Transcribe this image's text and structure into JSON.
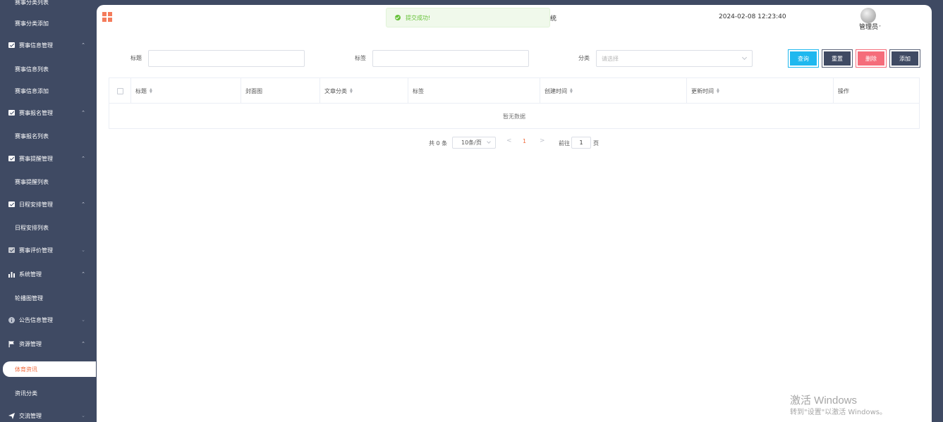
{
  "sidebar": {
    "items": [
      {
        "label": "赛事分类列表",
        "type": "item"
      },
      {
        "label": "赛事分类添加",
        "type": "item"
      },
      {
        "label": "赛事信息管理",
        "type": "group",
        "icon": "chart-box-icon",
        "caret": "^"
      },
      {
        "label": "赛事信息列表",
        "type": "item"
      },
      {
        "label": "赛事信息添加",
        "type": "item"
      },
      {
        "label": "赛事报名管理",
        "type": "group",
        "icon": "chart-box-icon",
        "caret": "^"
      },
      {
        "label": "赛事报名列表",
        "type": "item"
      },
      {
        "label": "赛事提醒管理",
        "type": "group",
        "icon": "chart-box-icon",
        "caret": "^"
      },
      {
        "label": "赛事提醒列表",
        "type": "item"
      },
      {
        "label": "日程安排管理",
        "type": "group",
        "icon": "chart-box-icon",
        "caret": "^"
      },
      {
        "label": "日程安排列表",
        "type": "item"
      },
      {
        "label": "赛事评价管理",
        "type": "group",
        "icon": "chart-box-icon",
        "caret": "v"
      },
      {
        "label": "系统管理",
        "type": "group",
        "icon": "bar-chart-icon",
        "caret": "^"
      },
      {
        "label": "轮播图管理",
        "type": "item"
      },
      {
        "label": "公告信息管理",
        "type": "group",
        "icon": "info-icon",
        "caret": "v"
      },
      {
        "label": "资源管理",
        "type": "group",
        "icon": "flag-icon",
        "caret": "^"
      },
      {
        "label": "体育资讯",
        "type": "item",
        "active": true
      },
      {
        "label": "资讯分类",
        "type": "item"
      },
      {
        "label": "交流管理",
        "type": "group",
        "icon": "send-icon",
        "caret": "v"
      }
    ]
  },
  "header": {
    "toast": "提交成功!",
    "title_fragment": "统",
    "datetime": "2024-02-08 12:23:40",
    "user": "管理员",
    "user_caret": "˅"
  },
  "search": {
    "title_label": "标题",
    "tag_label": "标签",
    "category_label": "分类",
    "category_placeholder": "请选择",
    "query": "查询",
    "reset": "重置",
    "delete": "删除",
    "add": "添加"
  },
  "table": {
    "columns": [
      "标题",
      "封面图",
      "文章分类",
      "标签",
      "创建时间",
      "更新时间",
      "操作"
    ],
    "empty_text": "暂无数据"
  },
  "pagination": {
    "total_text": "共 0 条",
    "page_size": "10条/页",
    "prev": "<",
    "current_page": "1",
    "next": ">",
    "goto_label": "前往",
    "goto_value": "1",
    "page_unit": "页"
  },
  "watermark": {
    "line1": "激活 Windows",
    "line2": "转到\"设置\"以激活 Windows。"
  }
}
